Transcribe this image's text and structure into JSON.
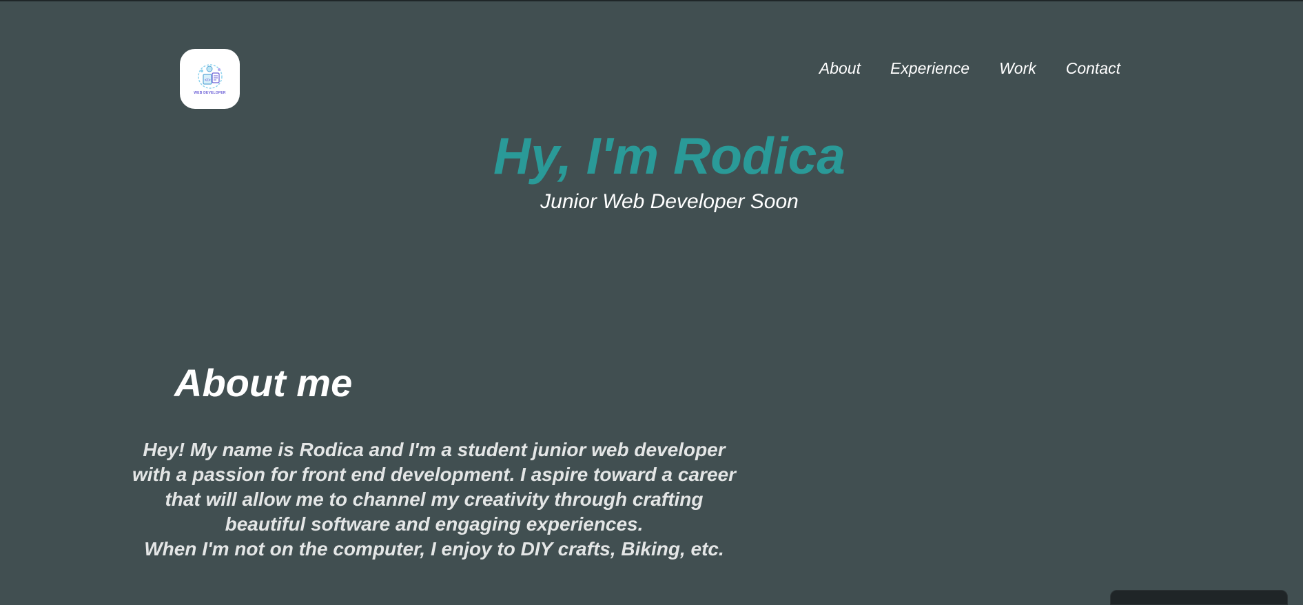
{
  "header": {
    "logo_text": "WEB DEVELOPER",
    "nav": [
      {
        "label": "About"
      },
      {
        "label": "Experience"
      },
      {
        "label": "Work"
      },
      {
        "label": "Contact"
      }
    ]
  },
  "hero": {
    "title": "Hy, I'm Rodica",
    "subtitle": "Junior Web Developer Soon"
  },
  "about": {
    "title": "About me",
    "lines": [
      "Hey! My name is Rodica and I'm a student junior web developer",
      "with a passion for front end development. I aspire toward a career",
      "that will allow me to channel my creativity through crafting",
      "beautiful software and engaging experiences.",
      "When I'm not on the computer, I enjoy to DIY crafts, Biking, etc."
    ]
  },
  "colors": {
    "background": "#414f51",
    "accent": "#2a9a98",
    "text": "#ffffff"
  }
}
